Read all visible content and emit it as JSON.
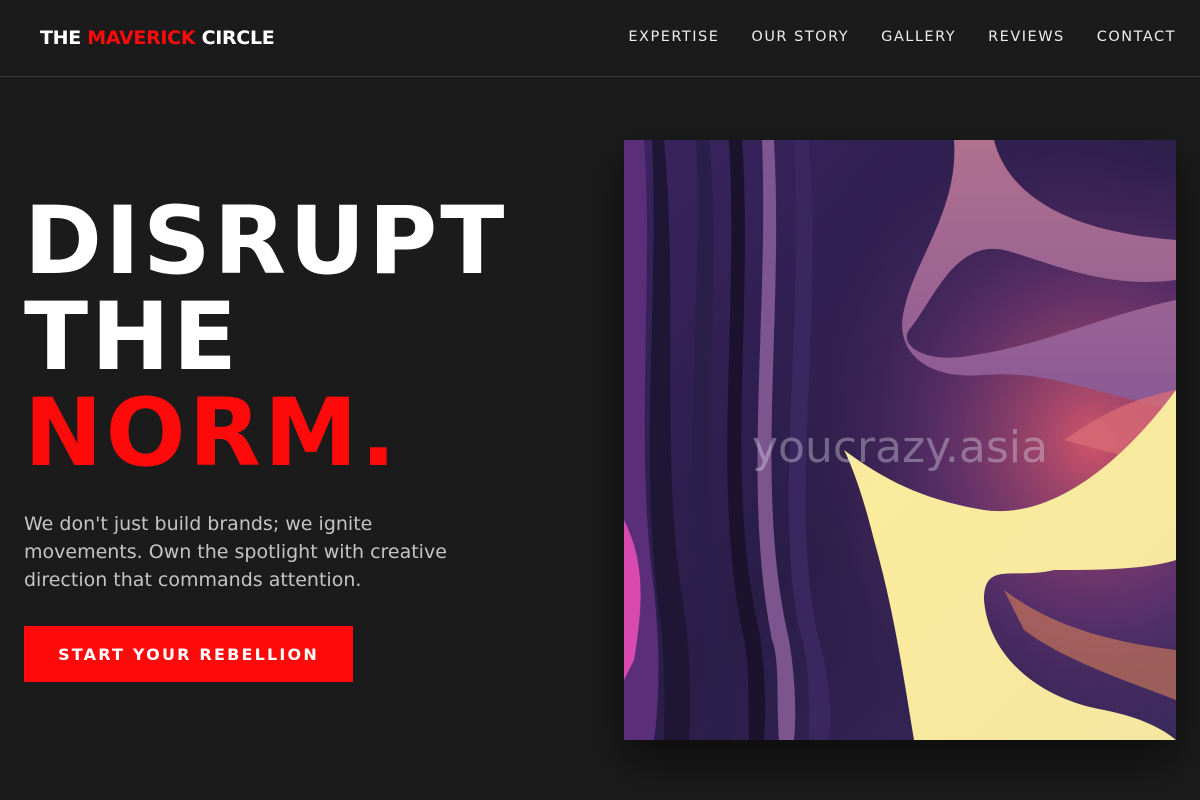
{
  "brand": {
    "part1": "THE ",
    "part2": "MAVERICK",
    "part3": " CIRCLE",
    "accent_color": "#ff0a0a"
  },
  "nav": {
    "items": [
      {
        "label": "EXPERTISE"
      },
      {
        "label": "OUR STORY"
      },
      {
        "label": "GALLERY"
      },
      {
        "label": "REVIEWS"
      },
      {
        "label": "CONTACT"
      }
    ]
  },
  "hero": {
    "line1": "DISRUPT",
    "line2": "THE",
    "line3": "NORM.",
    "description": "We don't just build brands; we ignite movements. Own the spotlight with creative direction that commands attention.",
    "cta_label": "START YOUR REBELLION",
    "image_watermark": "youcrazy.asia"
  },
  "colors": {
    "background": "#1b1b1c",
    "text": "#ffffff",
    "muted": "#c4c4c4",
    "accent": "#ff0a0a"
  }
}
